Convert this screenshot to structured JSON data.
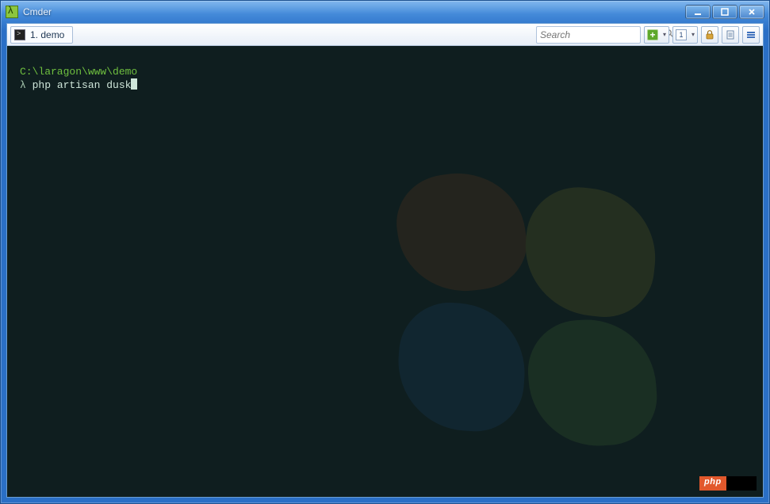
{
  "window": {
    "title": "Cmder"
  },
  "tab": {
    "label": "1. demo"
  },
  "search": {
    "placeholder": "Search"
  },
  "toolbar": {
    "num_label": "1"
  },
  "terminal": {
    "cwd": "C:\\laragon\\www\\demo",
    "prompt": "λ",
    "command": "php artisan dusk"
  },
  "badge": {
    "text": "php"
  }
}
